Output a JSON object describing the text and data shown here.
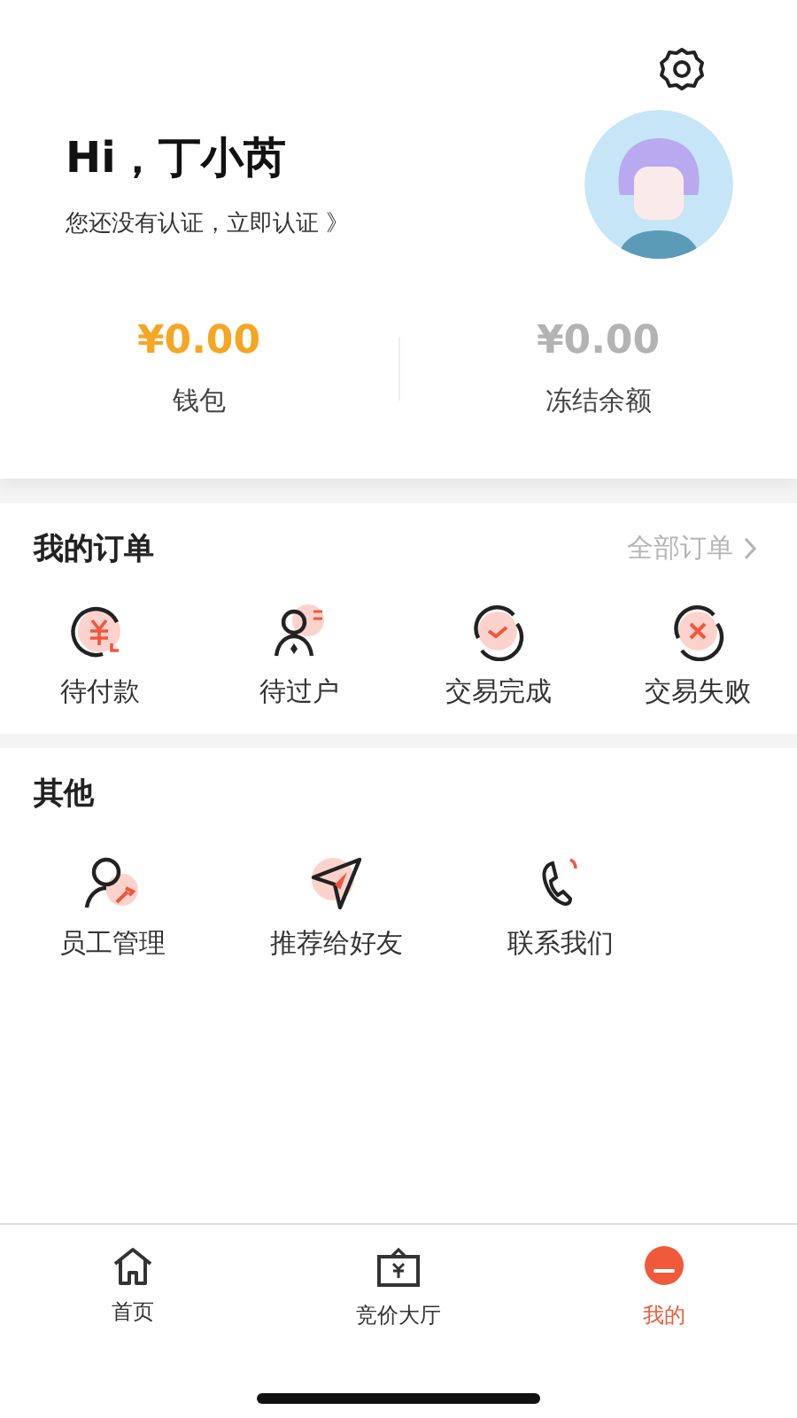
{
  "profile": {
    "greeting": "Hi，丁小芮",
    "verify_prompt": "您还没有认证，立即认证 》"
  },
  "balances": [
    {
      "amount": "¥0.00",
      "label": "钱包",
      "color": "#f5a623"
    },
    {
      "amount": "¥0.00",
      "label": "冻结余额",
      "color": "#b3b3b3"
    }
  ],
  "orders": {
    "title": "我的订单",
    "all_link": "全部订单",
    "items": [
      {
        "label": "待付款"
      },
      {
        "label": "待过户"
      },
      {
        "label": "交易完成"
      },
      {
        "label": "交易失败"
      }
    ]
  },
  "others": {
    "title": "其他",
    "items": [
      {
        "label": "员工管理"
      },
      {
        "label": "推荐给好友"
      },
      {
        "label": "联系我们"
      }
    ]
  },
  "tab_bar": [
    {
      "label": "首页",
      "selected": false
    },
    {
      "label": "竞价大厅",
      "selected": false
    },
    {
      "label": "我的",
      "selected": true
    }
  ]
}
